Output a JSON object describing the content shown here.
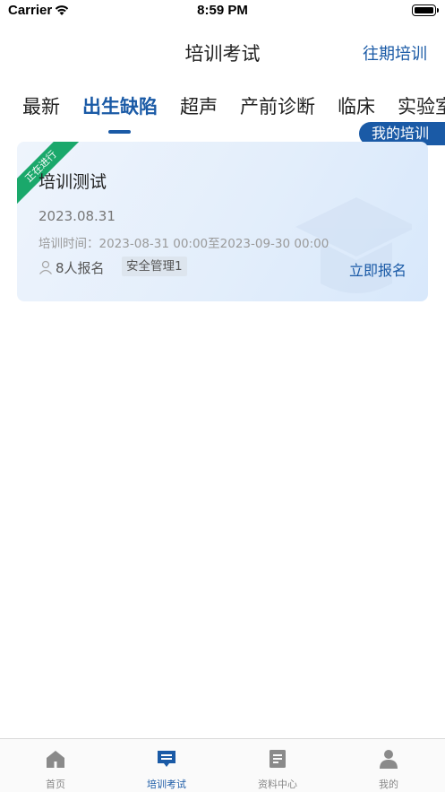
{
  "status_bar": {
    "carrier": "Carrier",
    "time": "8:59 PM"
  },
  "nav": {
    "title": "培训考试",
    "right_action": "往期培训"
  },
  "tabs": [
    {
      "label": "最新"
    },
    {
      "label": "出生缺陷",
      "active": true
    },
    {
      "label": "超声"
    },
    {
      "label": "产前诊断"
    },
    {
      "label": "临床"
    },
    {
      "label": "实验室"
    }
  ],
  "my_training_label": "我的培训",
  "card": {
    "ribbon": "正在进行",
    "title": "培训测试",
    "date": "2023.08.31",
    "time_range": "培训时间：2023-08-31 00:00至2023-09-30 00:00",
    "enrolled": "8人报名",
    "tag": "安全管理1",
    "action": "立即报名"
  },
  "bottom_tabs": [
    {
      "label": "首页",
      "icon": "home-icon"
    },
    {
      "label": "培训考试",
      "icon": "training-icon",
      "active": true
    },
    {
      "label": "资料中心",
      "icon": "document-icon"
    },
    {
      "label": "我的",
      "icon": "user-icon"
    }
  ],
  "colors": {
    "accent": "#1a5aa6",
    "ribbon": "#1aa86b",
    "inactive": "#888888"
  }
}
